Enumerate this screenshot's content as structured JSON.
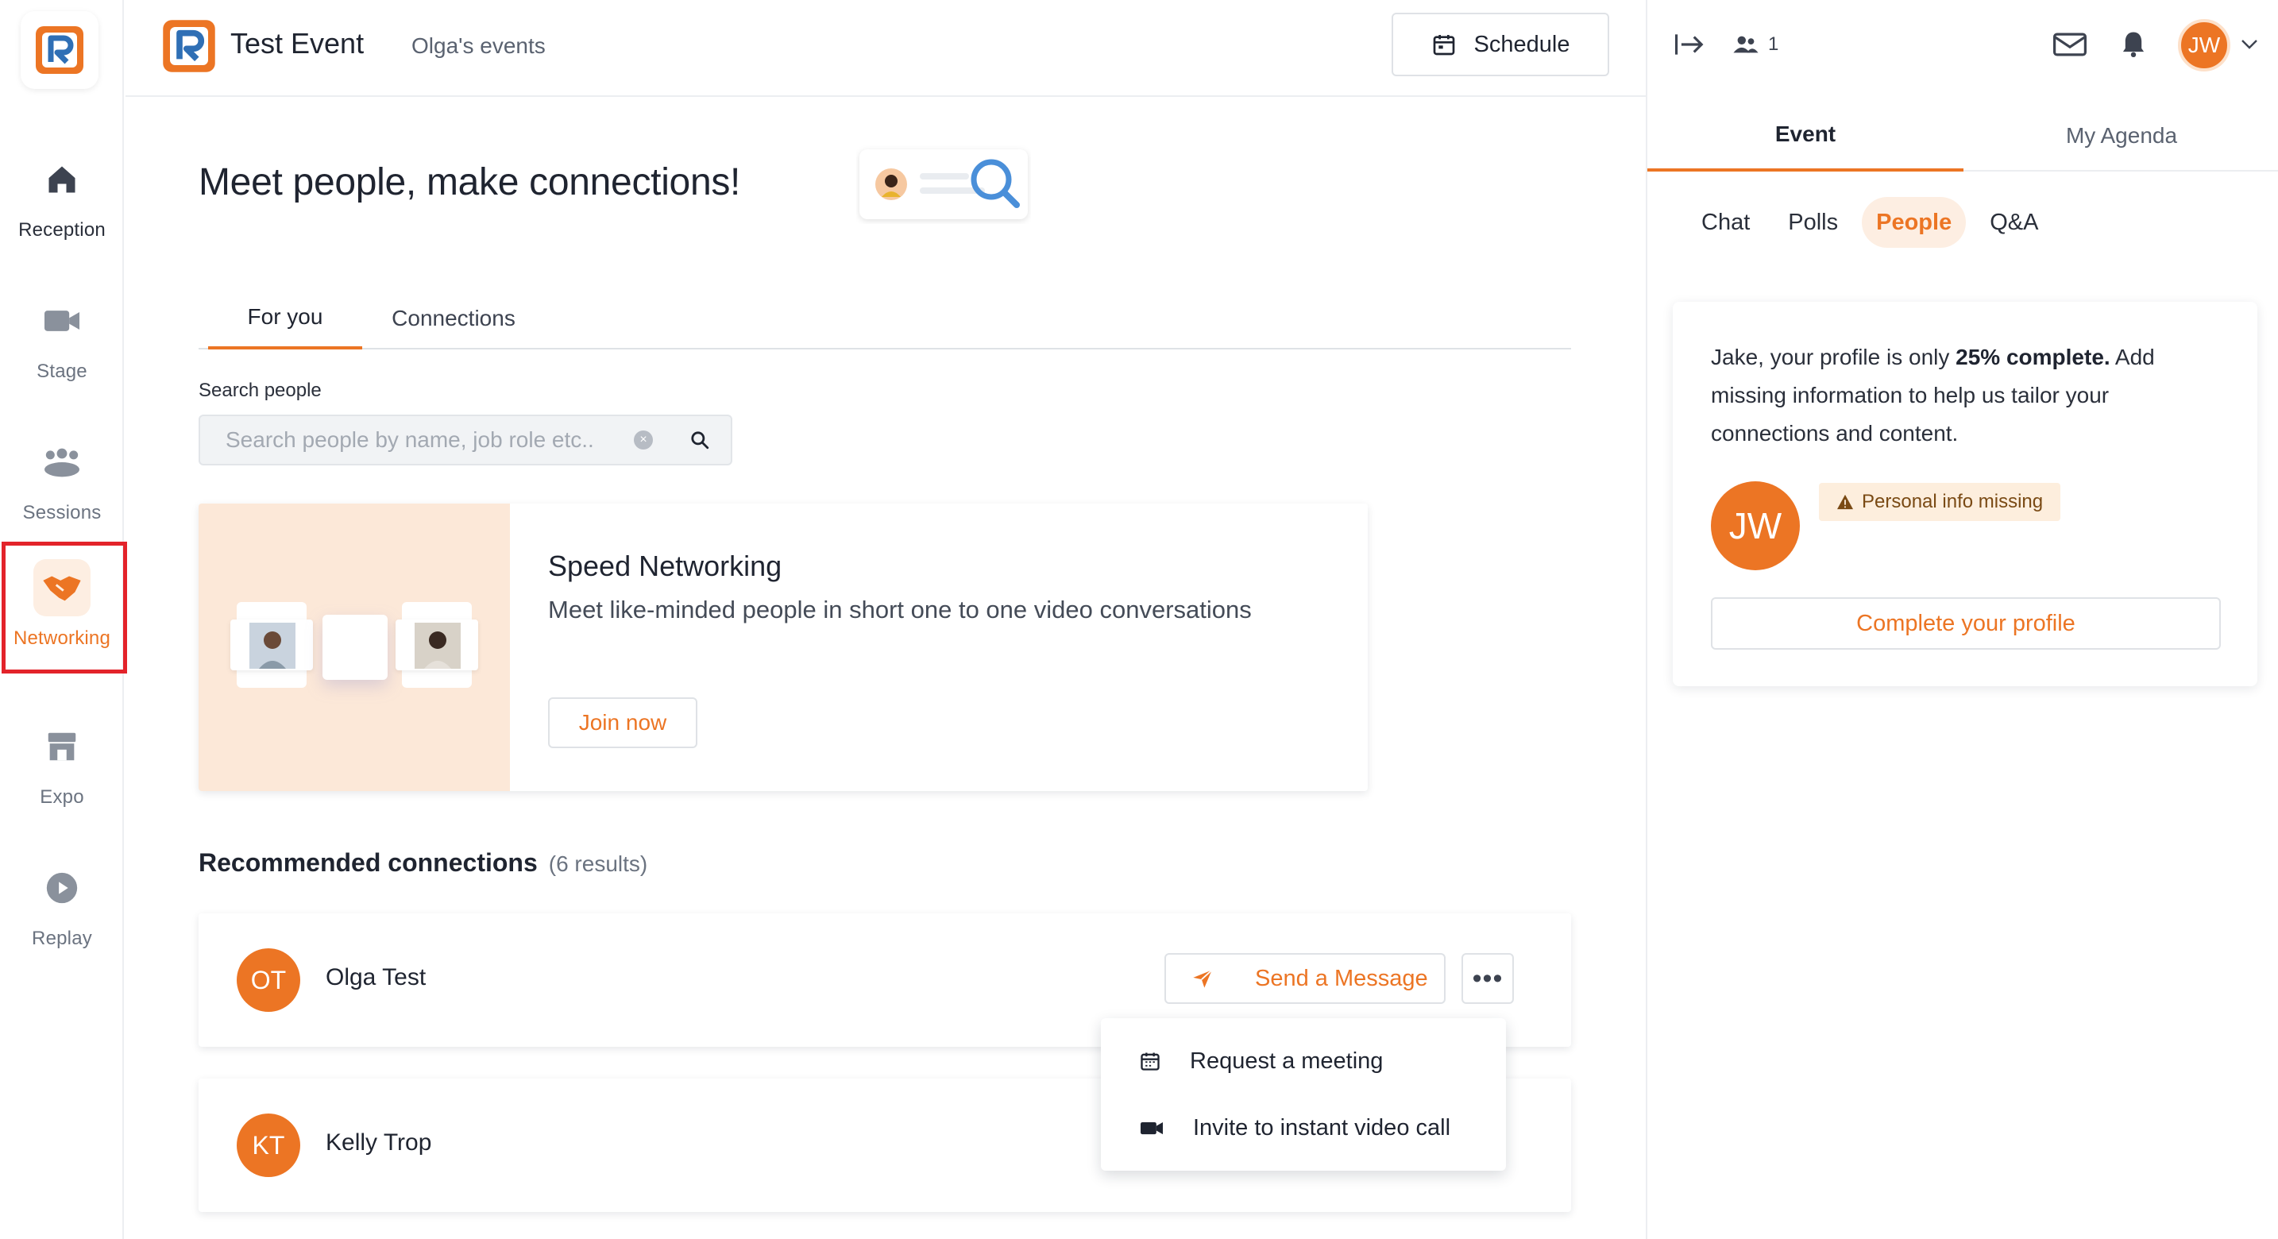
{
  "app": {
    "name": "Test Event",
    "organizer": "Olga's events"
  },
  "header": {
    "schedule_label": "Schedule"
  },
  "nav": {
    "items": [
      {
        "label": "Reception",
        "icon": "home-icon"
      },
      {
        "label": "Stage",
        "icon": "video-camera-icon"
      },
      {
        "label": "Sessions",
        "icon": "people-group-icon"
      },
      {
        "label": "Networking",
        "icon": "handshake-icon",
        "active": true
      },
      {
        "label": "Expo",
        "icon": "store-icon"
      },
      {
        "label": "Replay",
        "icon": "play-circle-icon"
      }
    ]
  },
  "main": {
    "title": "Meet people, make connections!",
    "tabs": [
      {
        "label": "For you",
        "active": true
      },
      {
        "label": "Connections",
        "active": false
      }
    ],
    "search": {
      "label": "Search people",
      "placeholder": "Search people by name, job role etc.."
    },
    "speed_networking": {
      "title": "Speed Networking",
      "description": "Meet like-minded people in short one to one video conversations",
      "button": "Join now"
    },
    "recommended": {
      "title": "Recommended connections",
      "count": "(6 results)",
      "people": [
        {
          "initials": "OT",
          "name": "Olga Test",
          "message_label": "Send a Message"
        },
        {
          "initials": "KT",
          "name": "Kelly Trop"
        }
      ]
    },
    "dropdown": {
      "items": [
        {
          "label": "Request a meeting",
          "icon": "calendar-icon"
        },
        {
          "label": "Invite to instant video call",
          "icon": "video-camera-icon"
        }
      ]
    }
  },
  "side": {
    "attendee_count": "1",
    "user_initials": "JW",
    "tabs": [
      {
        "label": "Event",
        "active": true
      },
      {
        "label": "My Agenda",
        "active": false
      }
    ],
    "sub_tabs": [
      {
        "label": "Chat"
      },
      {
        "label": "Polls"
      },
      {
        "label": "People",
        "active": true
      },
      {
        "label": "Q&A"
      }
    ],
    "profile": {
      "text_before": "Jake, your profile is only ",
      "text_bold": "25% complete.",
      "text_after": " Add missing information to help us tailor your connections and content.",
      "initials": "JW",
      "warning": "Personal info missing",
      "button": "Complete your profile"
    }
  },
  "colors": {
    "accent": "#ec7524",
    "brand_blue": "#2f6fb5",
    "highlight": "#e3232a"
  }
}
